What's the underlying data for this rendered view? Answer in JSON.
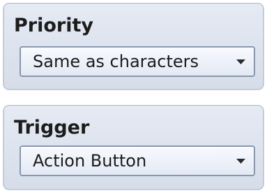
{
  "priority": {
    "label": "Priority",
    "selected_value": "Same as characters"
  },
  "trigger": {
    "label": "Trigger",
    "selected_value": "Action Button"
  },
  "colors": {
    "panel_background": "#dde3ee",
    "panel_border": "#c3ccdb",
    "dropdown_border": "#8a97ab",
    "text": "#1c1c1c"
  },
  "icons": {
    "dropdown_arrow": "chevron-down-icon"
  }
}
